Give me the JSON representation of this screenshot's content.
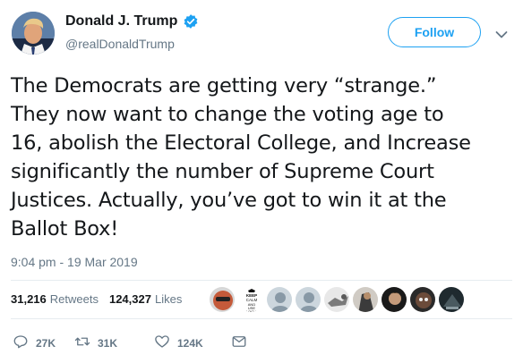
{
  "author": {
    "display_name": "Donald J. Trump",
    "handle": "@realDonaldTrump",
    "verified": true
  },
  "follow_button": {
    "label": "Follow"
  },
  "tweet": {
    "text": "The Democrats are getting very “strange.” They now want to change the voting age to 16, abolish the Electoral College, and Increase significantly the number of Supreme Court Justices. Actually, you’ve got to win it at the Ballot Box!",
    "lines": [
      "The Democrats are getting very “strange.”",
      "They now want to change the voting age to",
      "16, abolish the Electoral College, and Increase",
      "significantly the number of Supreme Court",
      "Justices. Actually, you’ve got to win it at the",
      "Ballot Box!"
    ],
    "timestamp": "9:04 pm - 19 Mar 2019"
  },
  "stats": {
    "retweets_count": "31,216",
    "retweets_label": "Retweets",
    "likes_count": "124,327",
    "likes_label": "Likes"
  },
  "liker_avatars": [
    {
      "name": "liker-avatar-1",
      "color": "#c45a3a"
    },
    {
      "name": "liker-avatar-2",
      "color": "#ffffff",
      "text": "KEEP CALM AND USE LOGIC"
    },
    {
      "name": "liker-avatar-3",
      "color": "#aab8c2"
    },
    {
      "name": "liker-avatar-4",
      "color": "#aab8c2"
    },
    {
      "name": "liker-avatar-5",
      "color": "#8d8d8d"
    },
    {
      "name": "liker-avatar-6",
      "color": "#3b3b3b"
    },
    {
      "name": "liker-avatar-7",
      "color": "#5a4636"
    },
    {
      "name": "liker-avatar-8",
      "color": "#2a2a2a"
    },
    {
      "name": "liker-avatar-9",
      "color": "#1f2a2f"
    }
  ],
  "actions": {
    "reply_count": "27K",
    "retweet_count": "31K",
    "like_count": "124K"
  },
  "colors": {
    "accent": "#1da1f2",
    "muted": "#657786",
    "text": "#14171a",
    "divider": "#e6ecf0"
  }
}
